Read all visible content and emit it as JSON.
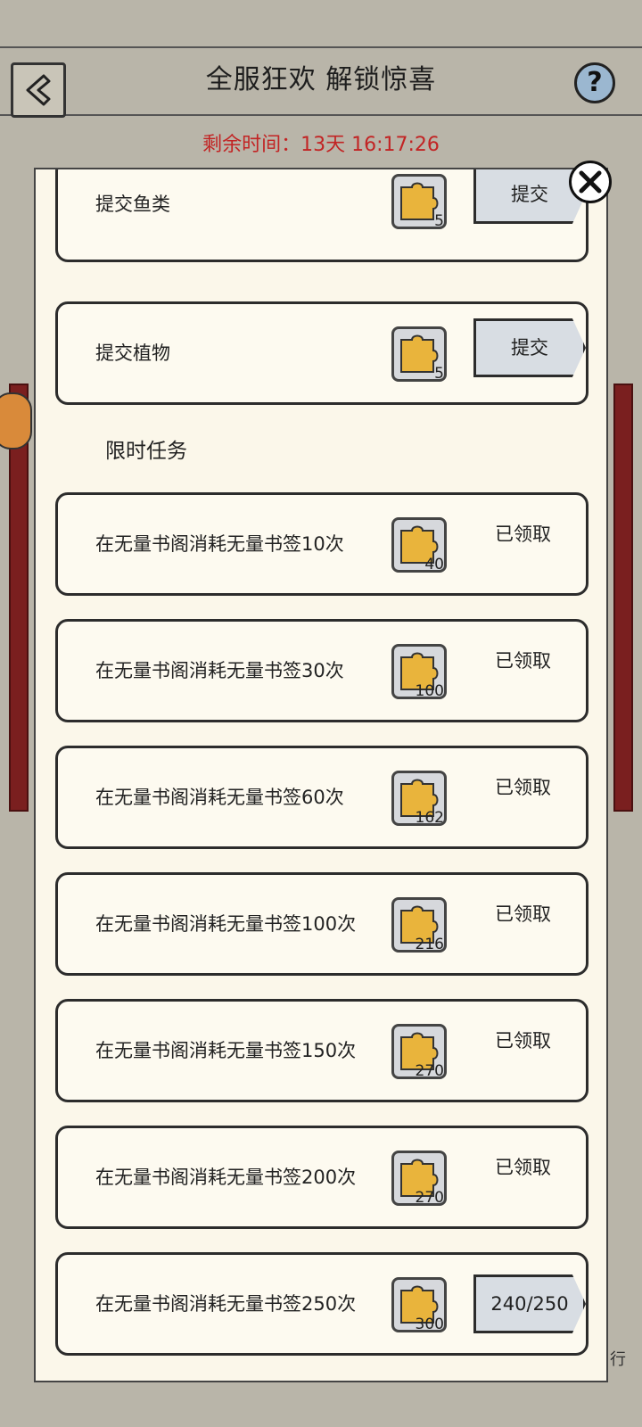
{
  "header": {
    "title": "全服狂欢 解锁惊喜",
    "help_label": "?",
    "timer": "剩余时间：13天 16:17:26"
  },
  "background": {
    "edge_text": "行"
  },
  "submit_tasks": [
    {
      "label": "提交鱼类",
      "reward": "5",
      "action": "提交"
    },
    {
      "label": "提交植物",
      "reward": "5",
      "action": "提交"
    }
  ],
  "limited_section": {
    "title": "限时任务",
    "tasks": [
      {
        "label": "在无量书阁消耗无量书签10次",
        "reward": "40",
        "status": "已领取"
      },
      {
        "label": "在无量书阁消耗无量书签30次",
        "reward": "100",
        "status": "已领取"
      },
      {
        "label": "在无量书阁消耗无量书签60次",
        "reward": "162",
        "status": "已领取"
      },
      {
        "label": "在无量书阁消耗无量书签100次",
        "reward": "216",
        "status": "已领取"
      },
      {
        "label": "在无量书阁消耗无量书签150次",
        "reward": "270",
        "status": "已领取"
      },
      {
        "label": "在无量书阁消耗无量书签200次",
        "reward": "270",
        "status": "已领取"
      },
      {
        "label": "在无量书阁消耗无量书签250次",
        "reward": "300",
        "progress": "240/250"
      }
    ]
  },
  "colors": {
    "timer_red": "#c22424",
    "puzzle_yellow": "#e9b43c",
    "panel_bg": "#fbf7ea",
    "page_bg": "#b9b5a9"
  },
  "icons": {
    "back": "back-arrow-icon",
    "help": "help-icon",
    "close": "close-icon",
    "reward": "puzzle-piece-icon"
  }
}
